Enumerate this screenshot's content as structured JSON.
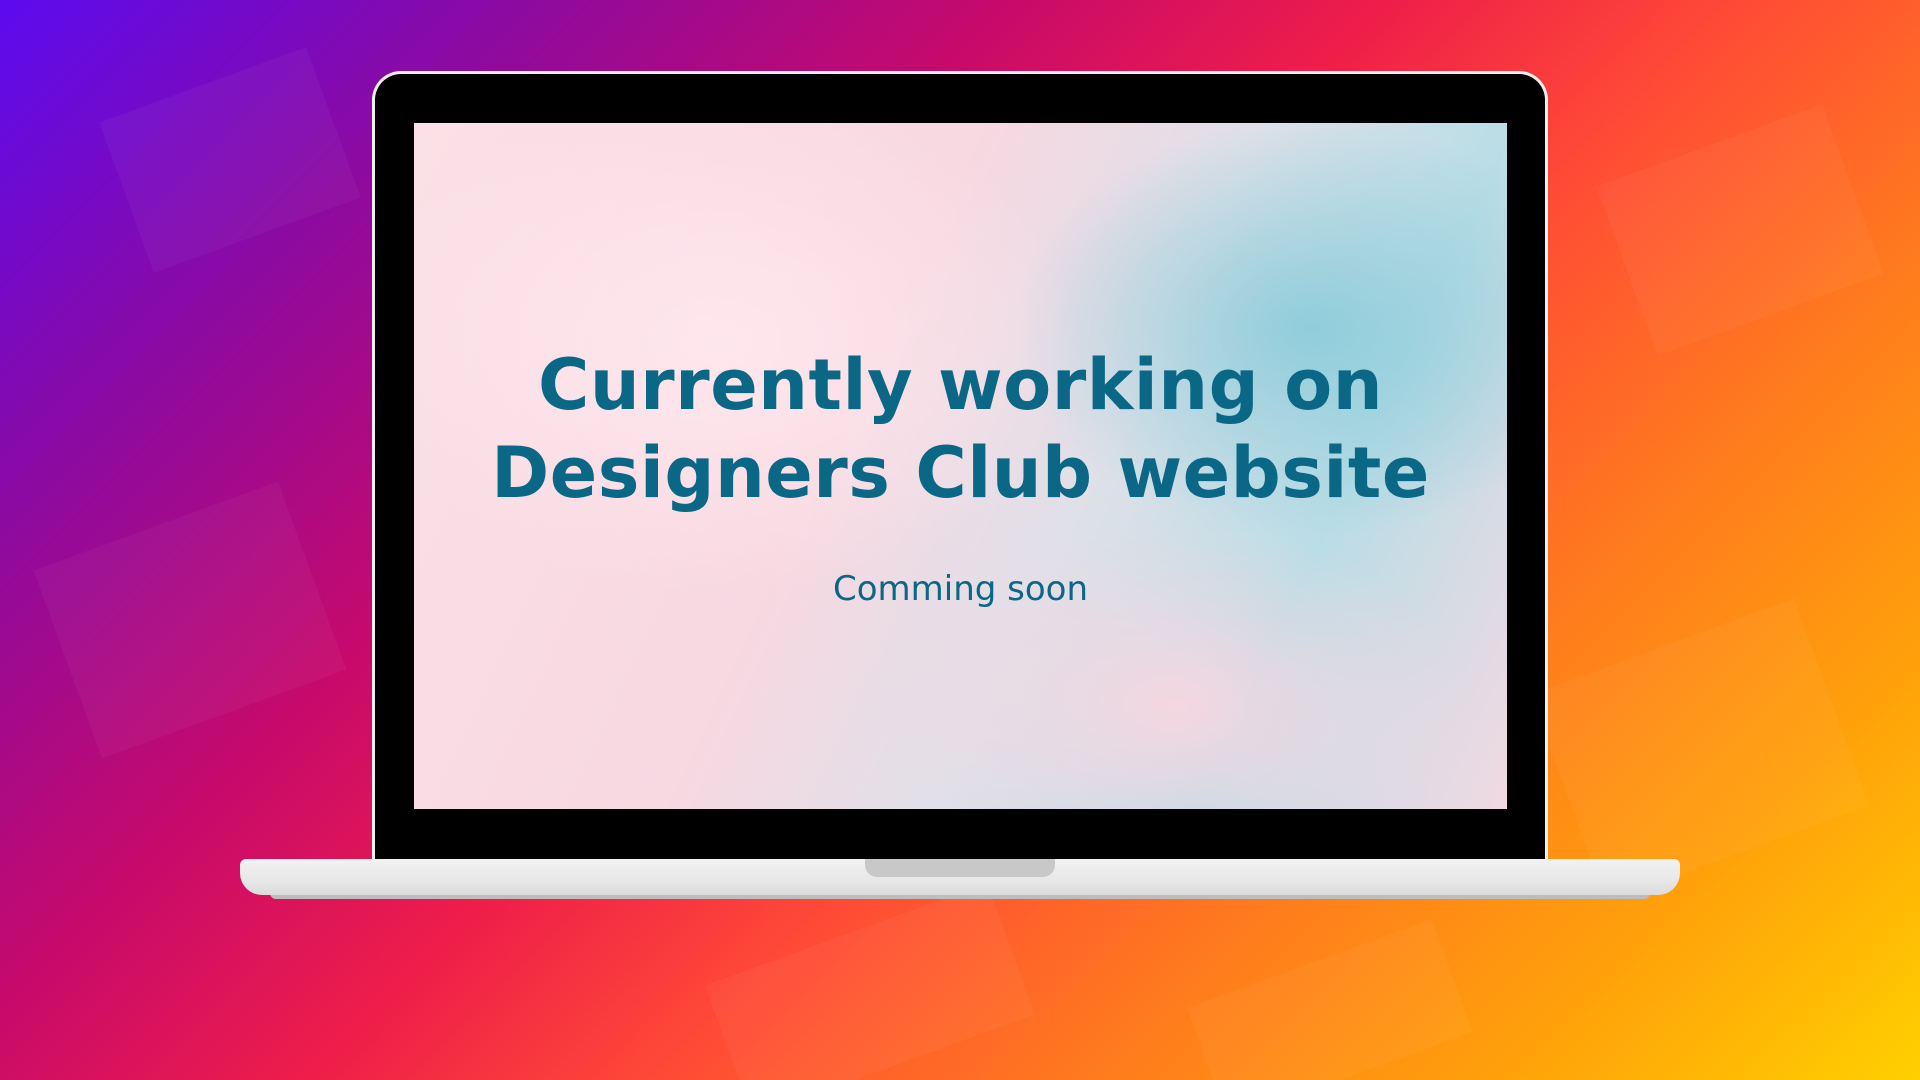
{
  "screen": {
    "headline_line1": "Currently working on",
    "headline_line2": "Designers Club website",
    "subtitle": "Comming soon"
  },
  "colors": {
    "text": "#0a6785",
    "background_gradient_start": "#5b0bf0",
    "background_gradient_end": "#ffd000",
    "laptop_bezel": "#000000",
    "laptop_base": "#ebebeb"
  }
}
